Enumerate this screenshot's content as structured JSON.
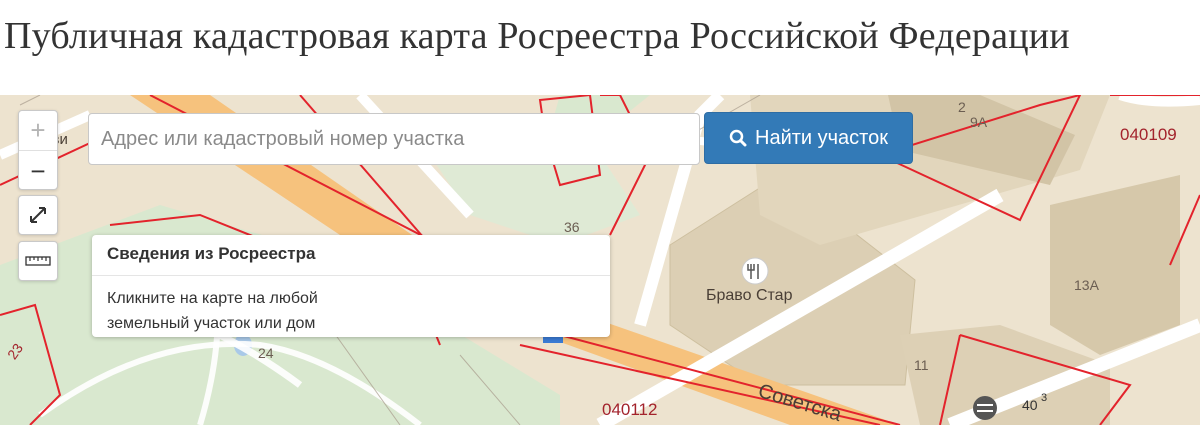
{
  "page": {
    "title": "Публичная кадастровая карта Росреестра Российской Федерации"
  },
  "search": {
    "placeholder": "Адрес или кадастровый номер участка",
    "value": "",
    "button_label": "Найти участок",
    "button_icon": "search-icon"
  },
  "controls": {
    "zoom_in": "+",
    "zoom_out": "−",
    "fullscreen_icon": "expand-icon",
    "ruler_icon": "ruler-icon"
  },
  "info_popup": {
    "title": "Сведения из Росреестра",
    "line1": "Кликните на карте на любой",
    "line2": "земельный участок или дом"
  },
  "map_labels": {
    "cadastral_quarter_1": "040109",
    "cadastral_quarter_2": "040112",
    "place_name": "Браво Стар",
    "street": "Советска",
    "partial_left": "Ми      уви",
    "houses": [
      "2",
      "9А",
      "36",
      "13А",
      "11",
      "24",
      "23",
      "40",
      "3"
    ]
  },
  "colors": {
    "accent": "#337ab7",
    "cadastral_border": "#e3232c",
    "road_main": "#f6c27d",
    "park": "#d9e8cf",
    "building": "#dccfb4"
  }
}
